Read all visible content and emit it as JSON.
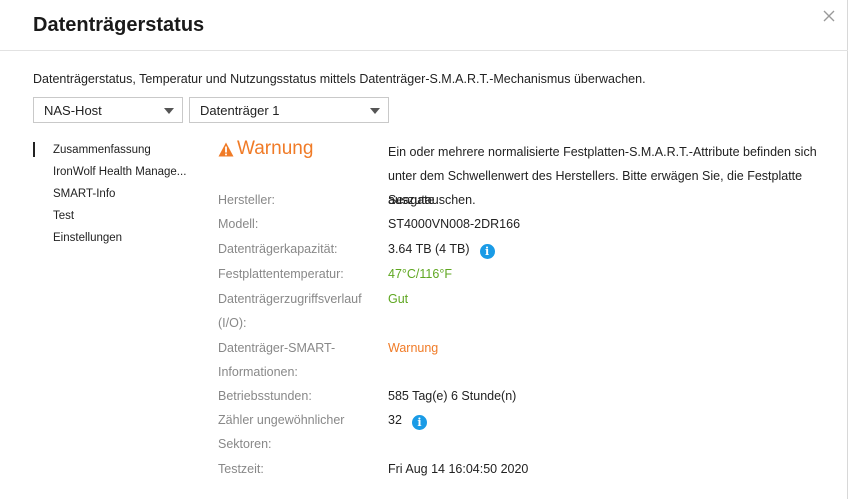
{
  "dialog": {
    "title": "Datenträgerstatus",
    "description": "Datenträgerstatus, Temperatur und Nutzungsstatus mittels Datenträger-S.M.A.R.T.-Mechanismus überwachen."
  },
  "selectors": {
    "host": "NAS-Host",
    "disk": "Datenträger 1"
  },
  "nav": {
    "items": [
      {
        "label": "Zusammenfassung"
      },
      {
        "label": "IronWolf Health Manage..."
      },
      {
        "label": "SMART-Info"
      },
      {
        "label": "Test"
      },
      {
        "label": "Einstellungen"
      }
    ]
  },
  "summary": {
    "status": "Warnung",
    "status_message": "Ein oder mehrere normalisierte Festplatten-S.M.A.R.T.-Attribute befinden sich unter dem Schwellenwert des Herstellers. Bitte erwägen Sie, die Festplatte auszutauschen.",
    "fields": {
      "manufacturer": {
        "label": "Hersteller:",
        "value": "Seagate"
      },
      "model": {
        "label": "Modell:",
        "value": "ST4000VN008-2DR166"
      },
      "capacity": {
        "label": "Datenträgerkapazität:",
        "value": "3.64 TB (4 TB)"
      },
      "temperature": {
        "label": "Festplattentemperatur:",
        "value": "47°C/116°F"
      },
      "access_history": {
        "label": "Datenträgerzugriffsverlauf (I/O):",
        "value": "Gut"
      },
      "smart_info": {
        "label": "Datenträger-SMART-Informationen:",
        "value": "Warnung"
      },
      "operating_hours": {
        "label": "Betriebsstunden:",
        "value": "585 Tag(e) 6 Stunde(n)"
      },
      "bad_sectors": {
        "label": "Zähler ungewöhnlicher Sektoren:",
        "value": "32"
      },
      "test_time": {
        "label": "Testzeit:",
        "value": "Fri Aug 14 16:04:50 2020"
      }
    }
  },
  "colors": {
    "warning": "#f07b27",
    "good": "#5fa721",
    "info": "#1a9be6"
  }
}
